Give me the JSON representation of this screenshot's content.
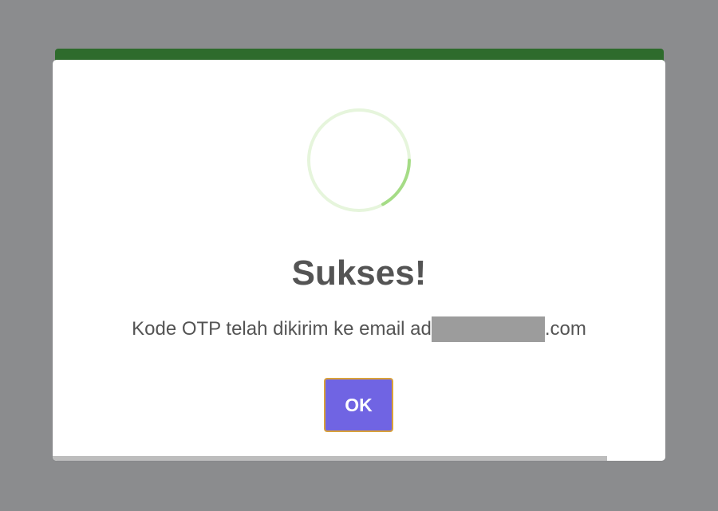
{
  "dialog": {
    "title": "Sukses!",
    "message_prefix": "Kode OTP telah dikirim ke email ad",
    "message_suffix": ".com",
    "ok_label": "OK",
    "timer_progress": 0.905
  },
  "icons": {
    "status_icon": "loading-spinner-icon"
  },
  "colors": {
    "overlay": "#8b8c8e",
    "header_green": "#2e6b2c",
    "spinner_track": "#e6f5dc",
    "spinner_arc": "#a5dc86",
    "title_text": "#545454",
    "ok_button": "#7064e3",
    "ok_button_border": "#d9a13a",
    "timer_bar": "#bdbdbd"
  }
}
